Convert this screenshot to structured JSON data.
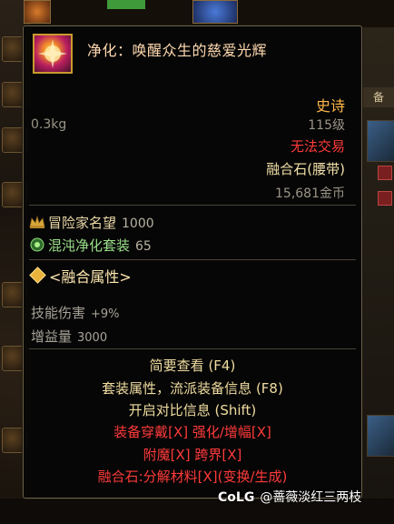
{
  "item": {
    "name": "净化：唤醒众生的慈爱光辉",
    "rarity": "史诗",
    "weight": "0.3kg",
    "level": "115级",
    "trade_status": "无法交易",
    "fusion_type": "融合石(腰带)",
    "price": "15,681金币",
    "icon": "item-icon"
  },
  "stats": {
    "fame_label": "冒险家名望",
    "fame_value": "1000",
    "fame_icon": "crown-icon",
    "set_label": "混沌净化套装",
    "set_value": "65",
    "set_icon": "set-emblem-icon"
  },
  "fusion_props": {
    "header": "<融合属性>",
    "attrs": [
      {
        "label": "技能伤害",
        "value": "+9%"
      },
      {
        "label": "增益量",
        "value": "3000"
      }
    ]
  },
  "hints": {
    "brief_view": "简要查看 (F4)",
    "set_info": "套装属性，流派装备信息 (F8)",
    "compare": "开启对比信息 (Shift)",
    "equip_line": "装备穿戴[X]   强化/增幅[X]",
    "enchant_line": "附魔[X]   跨界[X]",
    "fusion_line": "融合石:分解材料[X](变换/生成)"
  },
  "background": {
    "right_tab": "备"
  },
  "watermark": {
    "logo": "CoLG",
    "text": "@蔷薇淡红三两枝"
  },
  "colors": {
    "rarity": "#ffb74a",
    "untradable": "#ff3a3a",
    "set_name": "#9be08a",
    "frame_border": "#6d6146"
  }
}
